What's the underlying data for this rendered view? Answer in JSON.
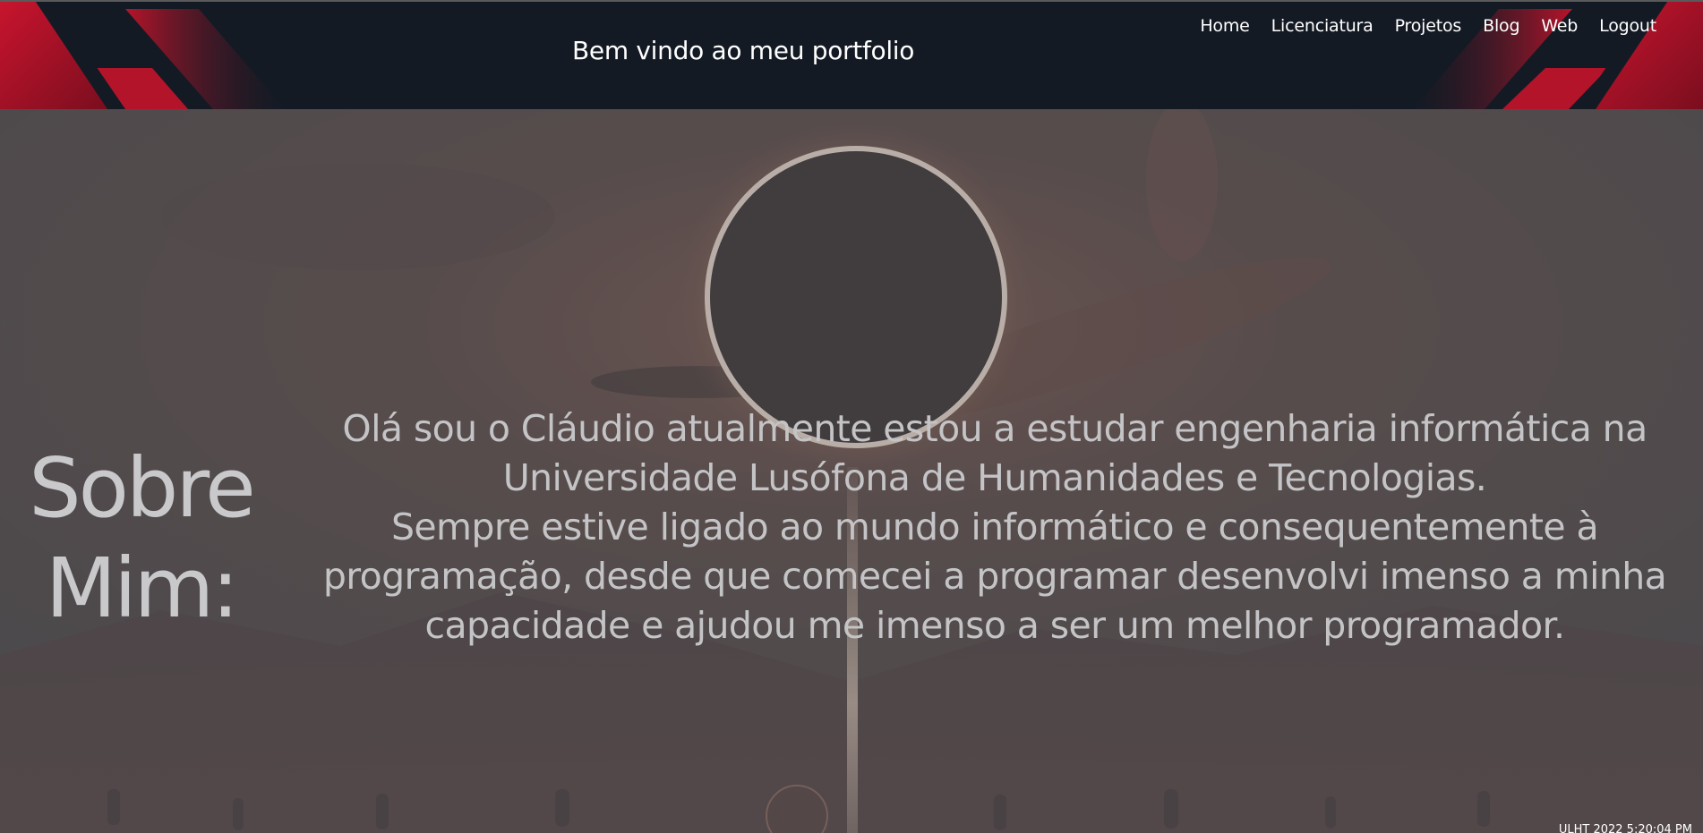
{
  "header": {
    "title": "Bem vindo ao meu portfolio",
    "nav": [
      {
        "label": "Home"
      },
      {
        "label": "Licenciatura"
      },
      {
        "label": "Projetos"
      },
      {
        "label": "Blog"
      },
      {
        "label": "Web"
      },
      {
        "label": "Logout"
      }
    ]
  },
  "about": {
    "heading_line1": "Sobre",
    "heading_line2": "Mim:",
    "paragraph1": "Olá sou o Cláudio atualmente estou a estudar engenharia informática na Universidade Lusófona de Humanidades e Tecnologias.",
    "paragraph2": "Sempre estive ligado ao mundo informático e consequentemente à programação, desde que comecei a programar desenvolvi imenso a minha capacidade e ajudou me imenso a ser um melhor programador."
  },
  "footer": {
    "stamp": "ULHT 2022 5:20:04 PM"
  },
  "colors": {
    "header_bg": "#141a24",
    "accent_red": "#b0142a",
    "overlay": "#4b4b4d"
  }
}
